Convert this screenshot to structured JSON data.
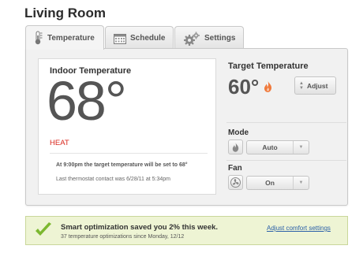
{
  "header": {
    "room": "Living Room"
  },
  "tabs": [
    {
      "label": "Temperature",
      "icon": "thermometer-icon",
      "active": true
    },
    {
      "label": "Schedule",
      "icon": "calendar-icon",
      "active": false
    },
    {
      "label": "Settings",
      "icon": "gears-icon",
      "active": false
    }
  ],
  "indoor": {
    "label": "Indoor Temperature",
    "value": "68°",
    "mode_status": "HEAT",
    "schedule_note": "At 9:00pm the target temperature will be set to 68°",
    "contact_note": "Last thermostat contact was 6/28/11 at 5:34pm"
  },
  "target": {
    "label": "Target Temperature",
    "value": "60°",
    "adjust_label": "Adjust"
  },
  "mode": {
    "label": "Mode",
    "value": "Auto"
  },
  "fan": {
    "label": "Fan",
    "value": "On"
  },
  "banner": {
    "title": "Smart optimization saved you 2% this week.",
    "subtitle": "37 temperature optimizations since Monday, 12/12",
    "link": "Adjust comfort settings"
  },
  "colors": {
    "heat": "#d9261c",
    "flame": "#f07a3c",
    "link": "#2a5fa8",
    "check": "#7cb82f",
    "banner_bg": "#eef4d4"
  }
}
